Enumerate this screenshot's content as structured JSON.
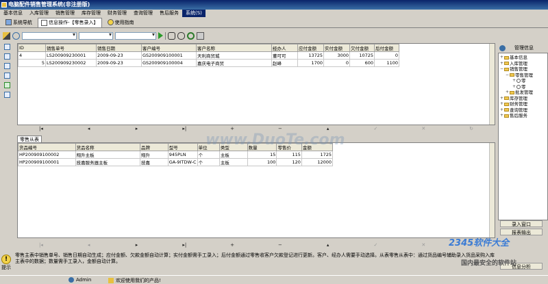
{
  "window": {
    "title": "电脑配件销售管理系统(非注册版)"
  },
  "menu": [
    "基本信息",
    "入库管理",
    "销售管理",
    "库存管理",
    "财务管理",
    "查询管理",
    "售后服务",
    "系统(S)"
  ],
  "tabs": [
    {
      "label": "系统导航"
    },
    {
      "label": "信息操作-【零售录入】"
    },
    {
      "label": "使用指南"
    }
  ],
  "main_table": {
    "columns": [
      "ID",
      "销售单号",
      "销售日期",
      "客户编号",
      "客户名称",
      "经办人",
      "应付金额",
      "实付金额",
      "欠付金额",
      "后付金额"
    ],
    "rows": [
      [
        "4",
        "LS200909230001",
        "2009-09-23",
        "GS200909100001",
        "天利商贸城",
        "董可可",
        "13725",
        "3000",
        "10725",
        "0"
      ],
      [
        "5",
        "LS200909230002",
        "2009-09-23",
        "GS200909100004",
        "嘉庆电子商贸",
        "赵峰",
        "1700",
        "0",
        "600",
        "1100"
      ]
    ]
  },
  "subtab": {
    "label": "零售从表"
  },
  "detail_table": {
    "columns": [
      "货品编号",
      "货品名称",
      "品牌",
      "型号",
      "单位",
      "类型",
      "数量",
      "零售价",
      "金额"
    ],
    "rows": [
      [
        "HP200909100002",
        "翔升主板",
        "翔升",
        "945PLN",
        "个",
        "主板",
        "15",
        "115",
        "1725"
      ],
      [
        "HP200909100001",
        "技嘉服务器主板",
        "技嘉",
        "GA-9ITDW-C",
        "个",
        "主板",
        "100",
        "120",
        "12000"
      ]
    ]
  },
  "hint": {
    "label": "提示",
    "text": "零售主表中销售单号、销售日期自动生成；应付金额、欠款金额自动计算；实付金额需手工录入；后付金额通过零售收客户欠款登记进行更新。客户、经办人需要手动选择。从表零售从表中：通过货品编号辅助录入货品采购入库主表中的数据；数量需手工录入，金额自动计算。"
  },
  "status": {
    "user": "Admin",
    "message": "欢迎使用我们的产品!"
  },
  "right_panel": {
    "title": "管理信息",
    "tree": [
      {
        "label": "基本信息",
        "level": 0
      },
      {
        "label": "入库管理",
        "level": 0
      },
      {
        "label": "销售管理",
        "level": 0
      },
      {
        "label": "零售管理",
        "level": 1
      },
      {
        "label": "零",
        "level": 2
      },
      {
        "label": "零",
        "level": 2
      },
      {
        "label": "批发管理",
        "level": 1
      },
      {
        "label": "库存管理",
        "level": 0
      },
      {
        "label": "财务管理",
        "level": 0
      },
      {
        "label": "查询管理",
        "level": 0
      },
      {
        "label": "售后服务",
        "level": 0
      }
    ],
    "buttons": [
      "录入窗口",
      "报表输出",
      "信息分析"
    ]
  },
  "watermarks": {
    "main": "www.DuoTe.com",
    "logo": "2345软件大全",
    "logo_sub": "国内最安全的软件站"
  },
  "colors": {
    "title_bar": "#0a246a",
    "selection": "#0a246a",
    "panel": "#d4d0c8"
  }
}
